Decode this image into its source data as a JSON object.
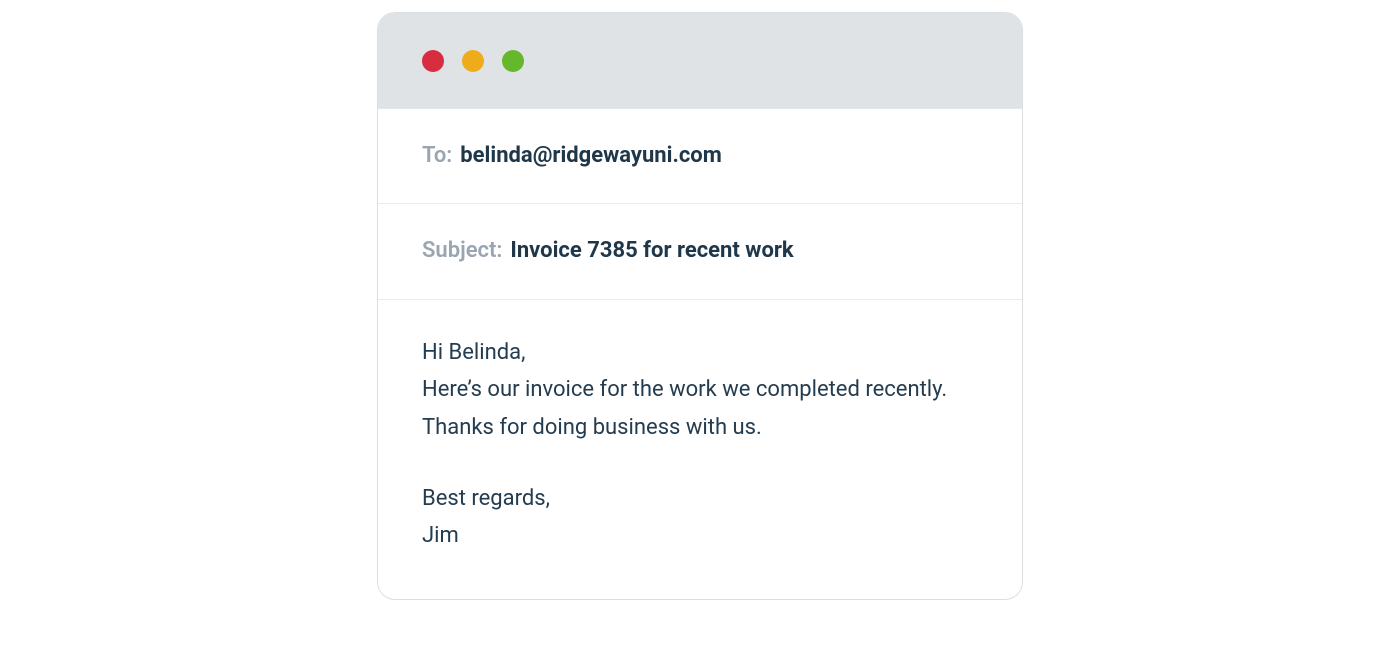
{
  "window": {
    "titlebar_colors": {
      "close": "#d82c40",
      "minimize": "#eeac1b",
      "maximize": "#65b72b"
    }
  },
  "email": {
    "to_label": "To:",
    "to_value": "belinda@ridgewayuni.com",
    "subject_label": "Subject:",
    "subject_value": "Invoice 7385 for recent work",
    "body_greeting": "Hi Belinda,",
    "body_line1": "Here’s our invoice for the work we completed recently.",
    "body_line2": "Thanks for doing business with us.",
    "body_signoff": "Best regards,",
    "body_signature": "Jim"
  }
}
